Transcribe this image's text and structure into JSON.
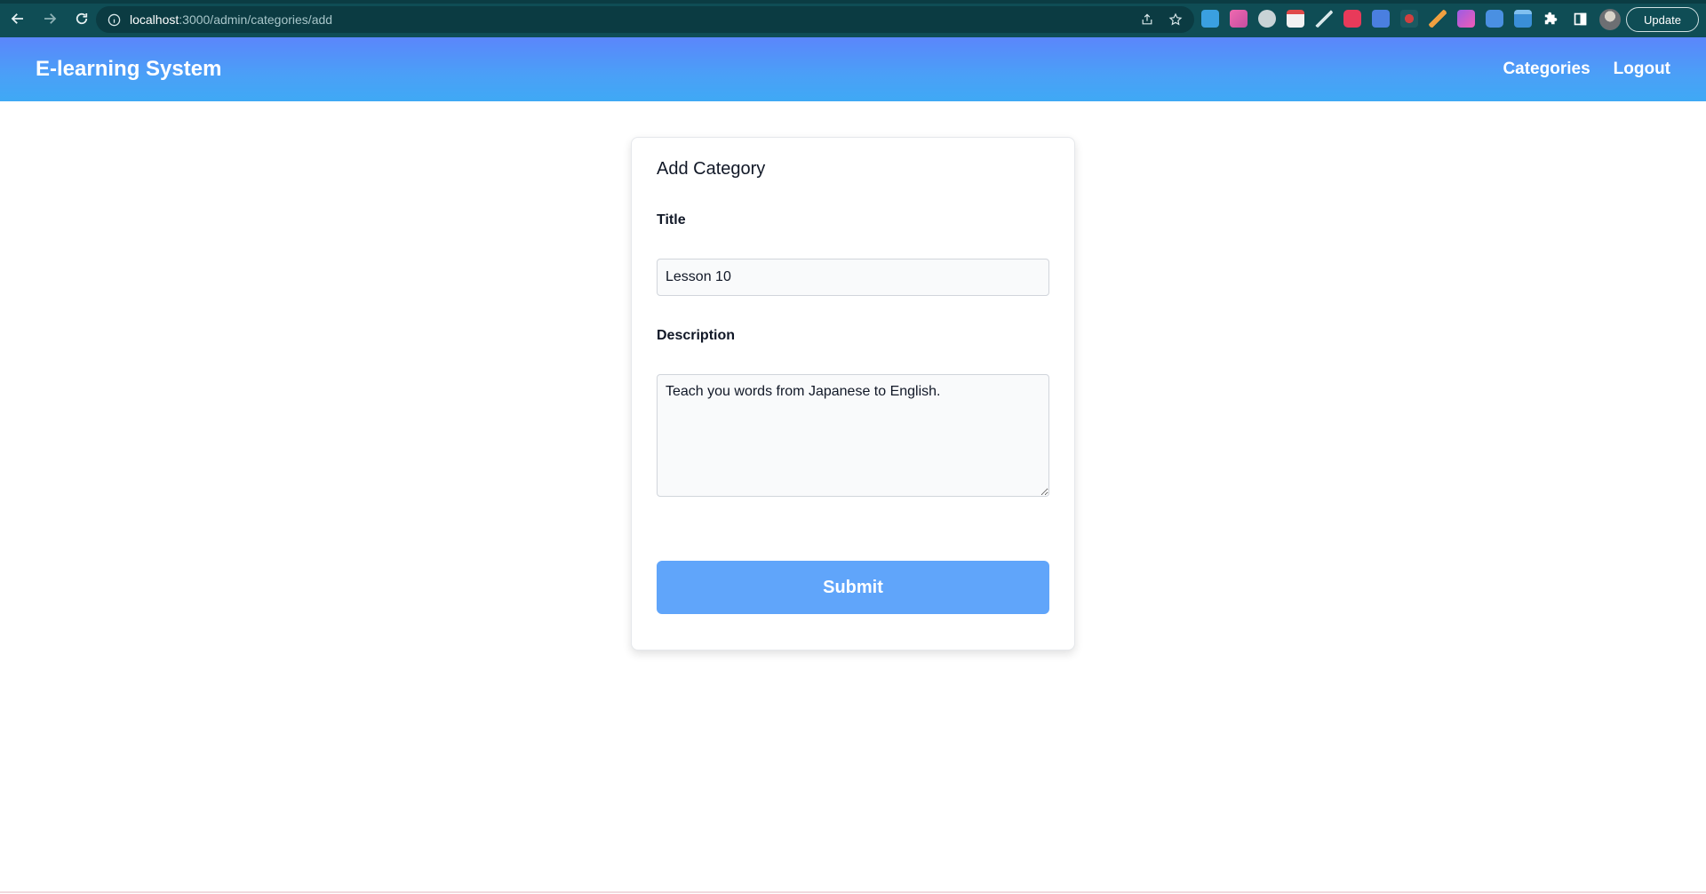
{
  "browser": {
    "url_host": "localhost",
    "url_path": ":3000/admin/categories/add",
    "update_label": "Update",
    "colors": {
      "chrome": "#0f4d55",
      "omnibox": "#0b3b42"
    },
    "extensions": [
      {
        "icon": "calendar-ext-icon",
        "color": "#3aa0e0"
      },
      {
        "icon": "pink-ext-icon",
        "color": "#e85aa8"
      },
      {
        "icon": "camera-ext-icon",
        "color": "#c9d3d6"
      },
      {
        "icon": "notes-ext-icon",
        "color": "#f2f2f2"
      },
      {
        "icon": "pen-ext-icon",
        "color": "#d9e8ea"
      },
      {
        "icon": "red-ext-icon",
        "color": "#e83a5a"
      },
      {
        "icon": "translate-ext-icon",
        "color": "#4a7fe0"
      },
      {
        "icon": "record-ext-icon",
        "color": "#d04040"
      },
      {
        "icon": "quill-ext-icon",
        "color": "#f0a040"
      },
      {
        "icon": "purple-ext-icon",
        "color": "#9b5de5"
      },
      {
        "icon": "font-ext-icon",
        "color": "#4a90e2"
      },
      {
        "icon": "window-ext-icon",
        "color": "#3a8fd8"
      },
      {
        "icon": "puzzle-icon",
        "color": "#ffffff"
      },
      {
        "icon": "sidepanel-icon",
        "color": "#ffffff"
      }
    ]
  },
  "header": {
    "brand": "E-learning System",
    "nav": [
      {
        "label": "Categories"
      },
      {
        "label": "Logout"
      }
    ],
    "colors": {
      "from": "#5b86fb",
      "to": "#3fa9f5"
    }
  },
  "form": {
    "title": "Add Category",
    "title_label": "Title",
    "title_value": "Lesson 10",
    "description_label": "Description",
    "description_value": "Teach you words from Japanese to English.",
    "submit_label": "Submit",
    "submit_color": "#60a5fa"
  }
}
